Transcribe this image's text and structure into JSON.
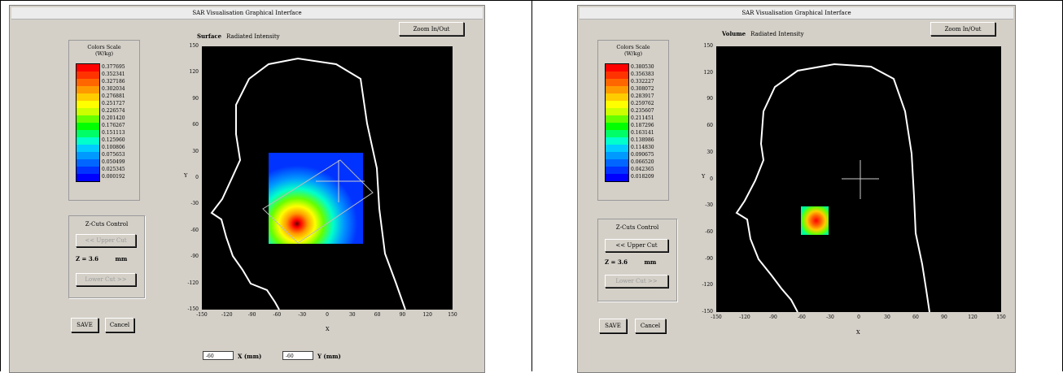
{
  "left": {
    "title": "SAR Visualisation Graphical Interface",
    "zoom_label": "Zoom In/Out",
    "plot_kind": "Surface",
    "plot_quantity": "Radiated Intensity",
    "scale_title": "Colors Scale",
    "scale_units": "(W/kg)",
    "scale_values": [
      "0.377695",
      "0.352341",
      "0.327186",
      "0.302034",
      "0.276881",
      "0.251727",
      "0.226574",
      "0.201420",
      "0.176267",
      "0.151113",
      "0.125960",
      "0.100806",
      "0.075653",
      "0.050499",
      "0.025345",
      "0.000192"
    ],
    "zcuts_title": "Z-Cuts Control",
    "upper_cut": "<< Upper Cut",
    "z_value": "Z = 3.6",
    "z_unit": "mm",
    "lower_cut": "Lower Cut >>",
    "save": "SAVE",
    "cancel": "Cancel",
    "y_ticks": [
      "150",
      "120",
      "90",
      "60",
      "30",
      "0",
      "-30",
      "-60",
      "-90",
      "-120",
      "-150"
    ],
    "x_ticks": [
      "-150",
      "-120",
      "-90",
      "-60",
      "-30",
      "0",
      "30",
      "60",
      "90",
      "120",
      "150"
    ],
    "y_axis": "Y",
    "x_axis": "X",
    "x_field": "-60",
    "x_field_label": "X (mm)",
    "y_field": "-60",
    "y_field_label": "Y (mm)"
  },
  "right": {
    "title": "SAR Visualisation Graphical Interface",
    "zoom_label": "Zoom In/Out",
    "plot_kind": "Volume",
    "plot_quantity": "Radiated Intensity",
    "scale_title": "Colors Scale",
    "scale_units": "(W/kg)",
    "scale_values": [
      "0.380530",
      "0.356383",
      "0.332227",
      "0.308072",
      "0.283917",
      "0.259762",
      "0.235607",
      "0.211451",
      "0.187296",
      "0.163141",
      "0.138986",
      "0.114830",
      "0.090675",
      "0.066520",
      "0.042365",
      "0.018209"
    ],
    "zcuts_title": "Z-Cuts Control",
    "upper_cut": "<< Upper Cut",
    "z_value": "Z = 3.6",
    "z_unit": "mm",
    "lower_cut": "Lower Cut >>",
    "save": "SAVE",
    "cancel": "Cancel",
    "y_ticks": [
      "150",
      "120",
      "90",
      "60",
      "30",
      "0",
      "-30",
      "-60",
      "-90",
      "-120",
      "-150"
    ],
    "x_ticks": [
      "-150",
      "-120",
      "-90",
      "-60",
      "-30",
      "0",
      "30",
      "60",
      "90",
      "120",
      "150"
    ],
    "y_axis": "Y",
    "x_axis": "X"
  },
  "scale_colors": [
    "#ff0000",
    "#ff3300",
    "#ff6600",
    "#ff9900",
    "#ffcc00",
    "#ffff00",
    "#ccff00",
    "#66ff00",
    "#00ff00",
    "#00ff66",
    "#00ffcc",
    "#00ccff",
    "#0099ff",
    "#0066ff",
    "#0033ff",
    "#0000ff"
  ]
}
